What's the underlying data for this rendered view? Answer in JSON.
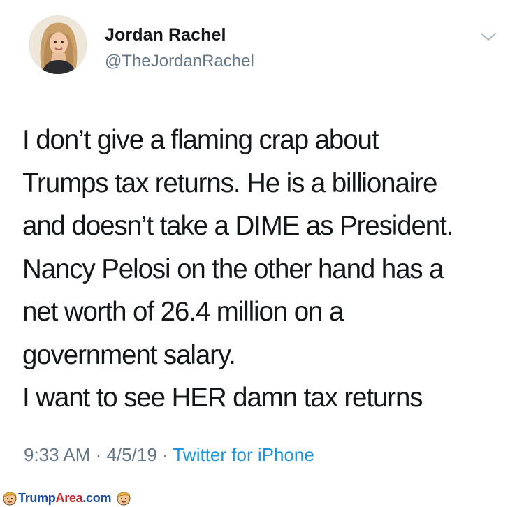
{
  "tweet": {
    "author": {
      "name": "Jordan Rachel",
      "handle": "@TheJordanRachel"
    },
    "menu_icon": "chevron-down-icon",
    "body_lines": [
      "I don’t give a flaming crap about",
      "Trumps tax returns. He is a billionaire",
      "and doesn’t take a DIME as President.",
      "Nancy Pelosi on the other hand has a",
      "net worth of 26.4 million on a",
      "government salary.",
      "I want to see HER damn tax returns"
    ],
    "time": "9:33 AM",
    "date": "4/5/19",
    "separator": "·",
    "source": "Twitter for iPhone"
  },
  "watermark": {
    "part1": "Trump",
    "part2": "Area",
    "part3": ".com"
  },
  "colors": {
    "text": "#14171a",
    "secondary": "#657786",
    "link": "#1b95e0"
  }
}
